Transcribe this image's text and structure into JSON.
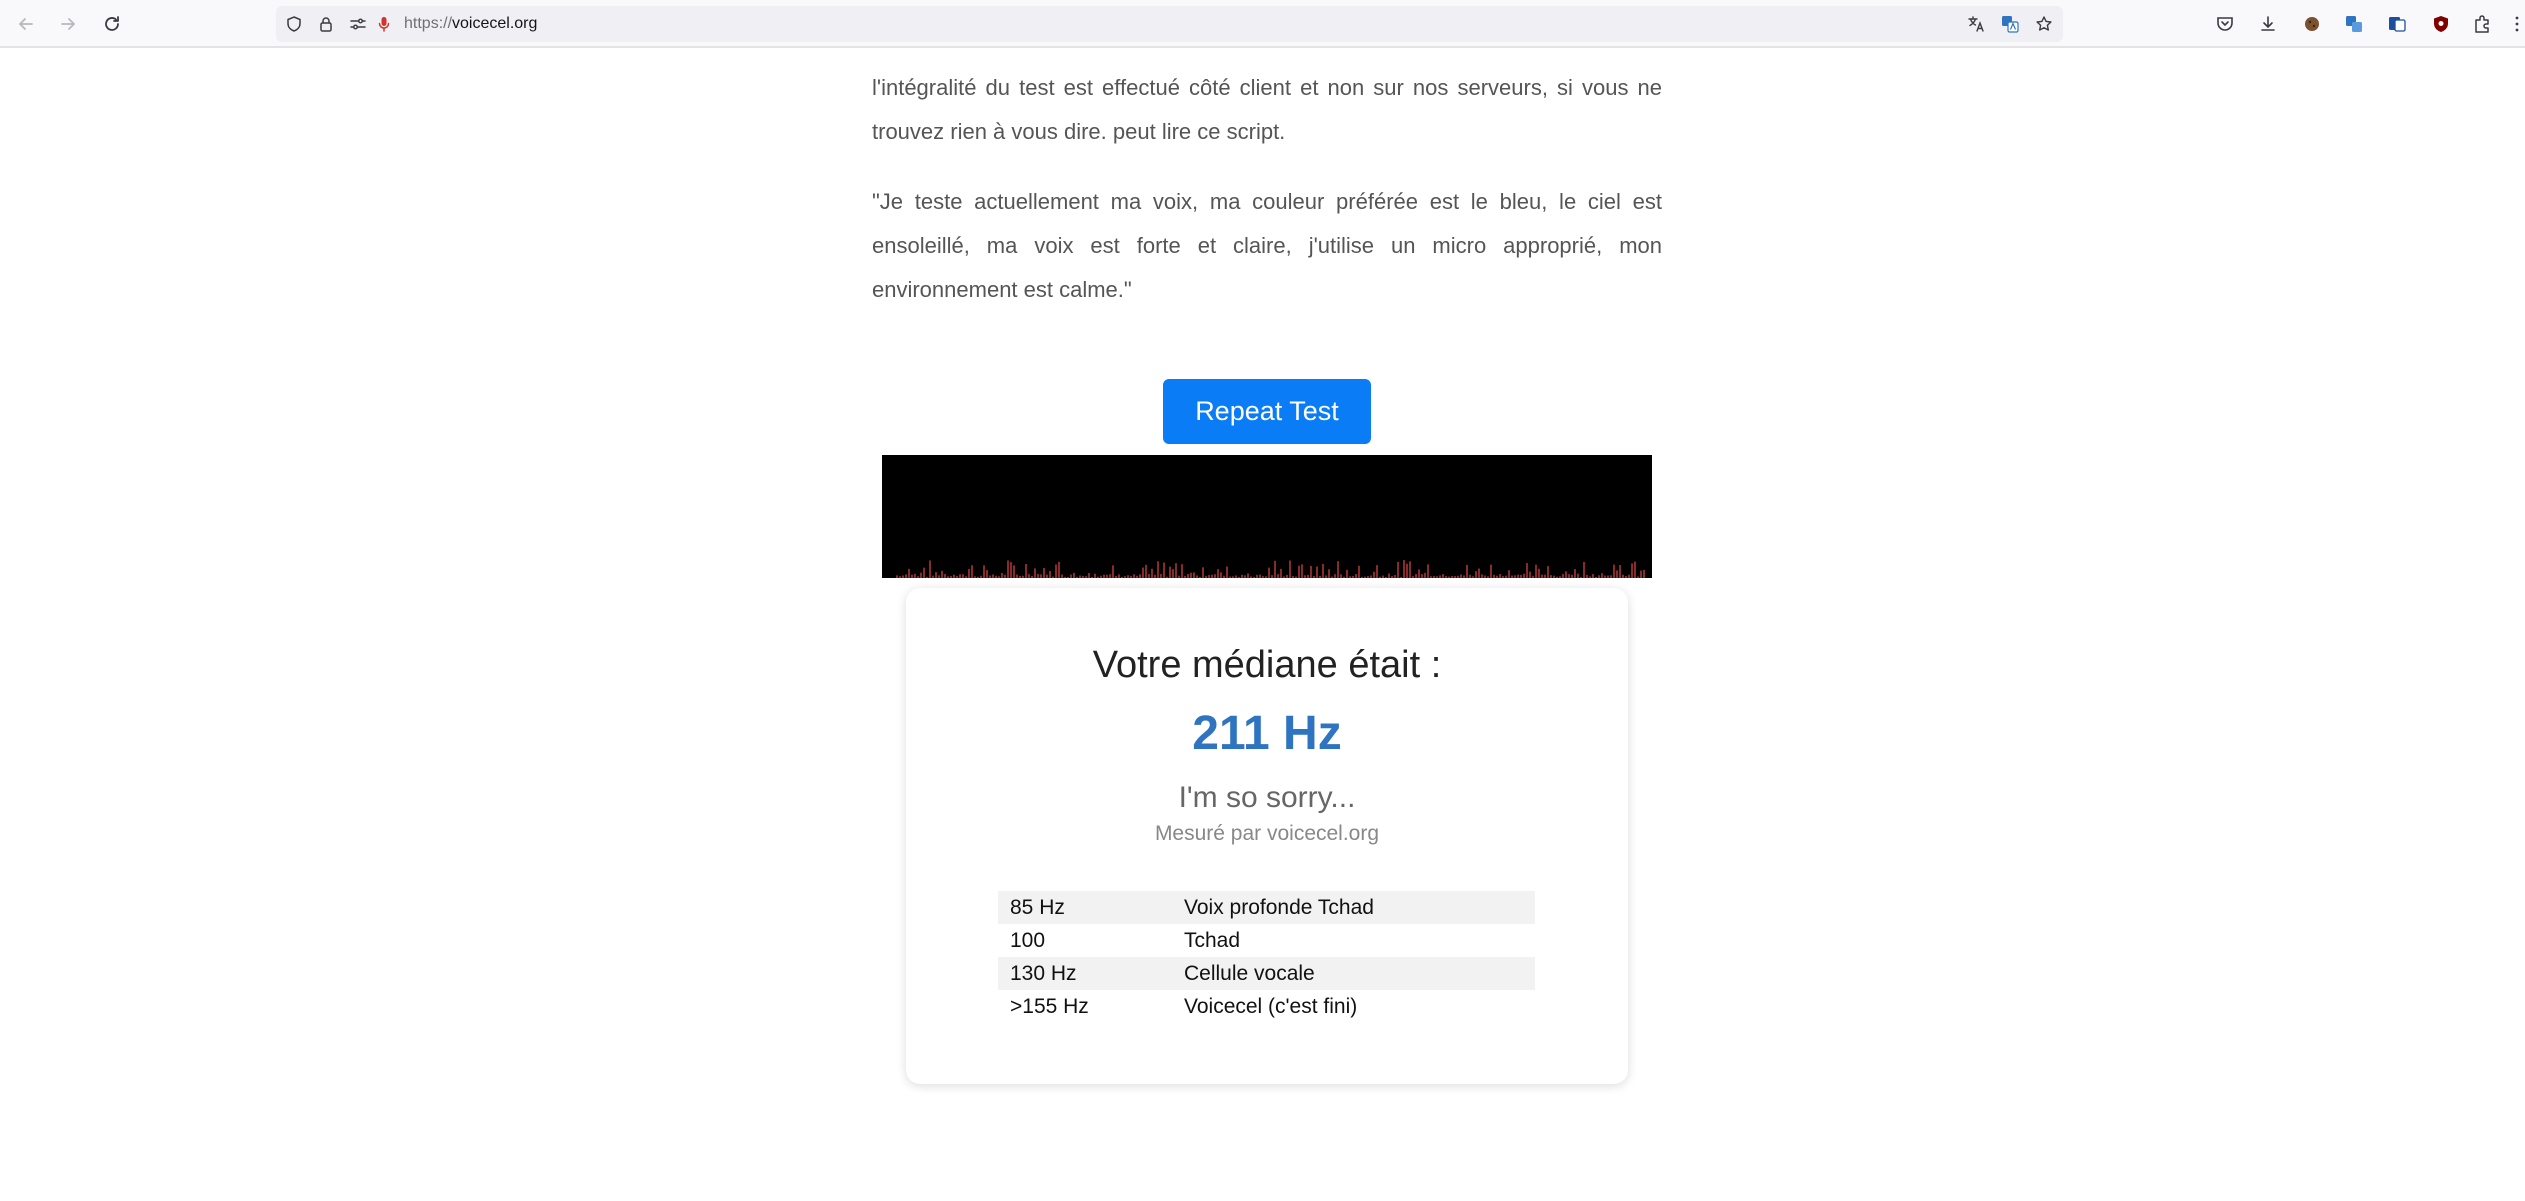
{
  "browser": {
    "url_scheme": "https://",
    "url_host": "voicecel.org"
  },
  "article": {
    "paragraph_1": "l'intégralité du test est effectué côté client et non sur nos serveurs, si vous ne trouvez rien à vous dire. peut lire ce script.",
    "paragraph_2": "\"Je teste actuellement ma voix, ma couleur préférée est le bleu, le ciel est ensoleillé, ma voix est forte et claire, j'utilise un micro approprié, mon environnement est calme.\""
  },
  "actions": {
    "repeat_label": "Repeat Test"
  },
  "result": {
    "median_label": "Votre médiane était :",
    "median_value": "211 Hz",
    "verdict": "I'm so sorry...",
    "measured_by": "Mesuré par voicecel.org"
  },
  "reference_table": [
    {
      "freq": "85 Hz",
      "label": "Voix profonde Tchad"
    },
    {
      "freq": "100",
      "label": "Tchad"
    },
    {
      "freq": "130 Hz",
      "label": "Cellule vocale"
    },
    {
      "freq": ">155 Hz",
      "label": "Voicecel (c'est fini)"
    }
  ],
  "colors": {
    "accent_button": "#0a7cf5",
    "median_value": "#2f74c0",
    "visualizer_bg": "#000000",
    "visualizer_bar": "#8a2b2b"
  },
  "icons": {
    "back": "arrow-left-icon",
    "forward": "arrow-right-icon",
    "reload": "reload-icon",
    "shield": "shield-icon",
    "lock": "lock-icon",
    "permissions": "permissions-icon",
    "microphone": "microphone-icon",
    "translate": "translate-icon",
    "bookmark": "star-icon",
    "pocket": "pocket-icon",
    "downloads": "download-icon",
    "extensions_menu": "overflow-menu-icon"
  }
}
